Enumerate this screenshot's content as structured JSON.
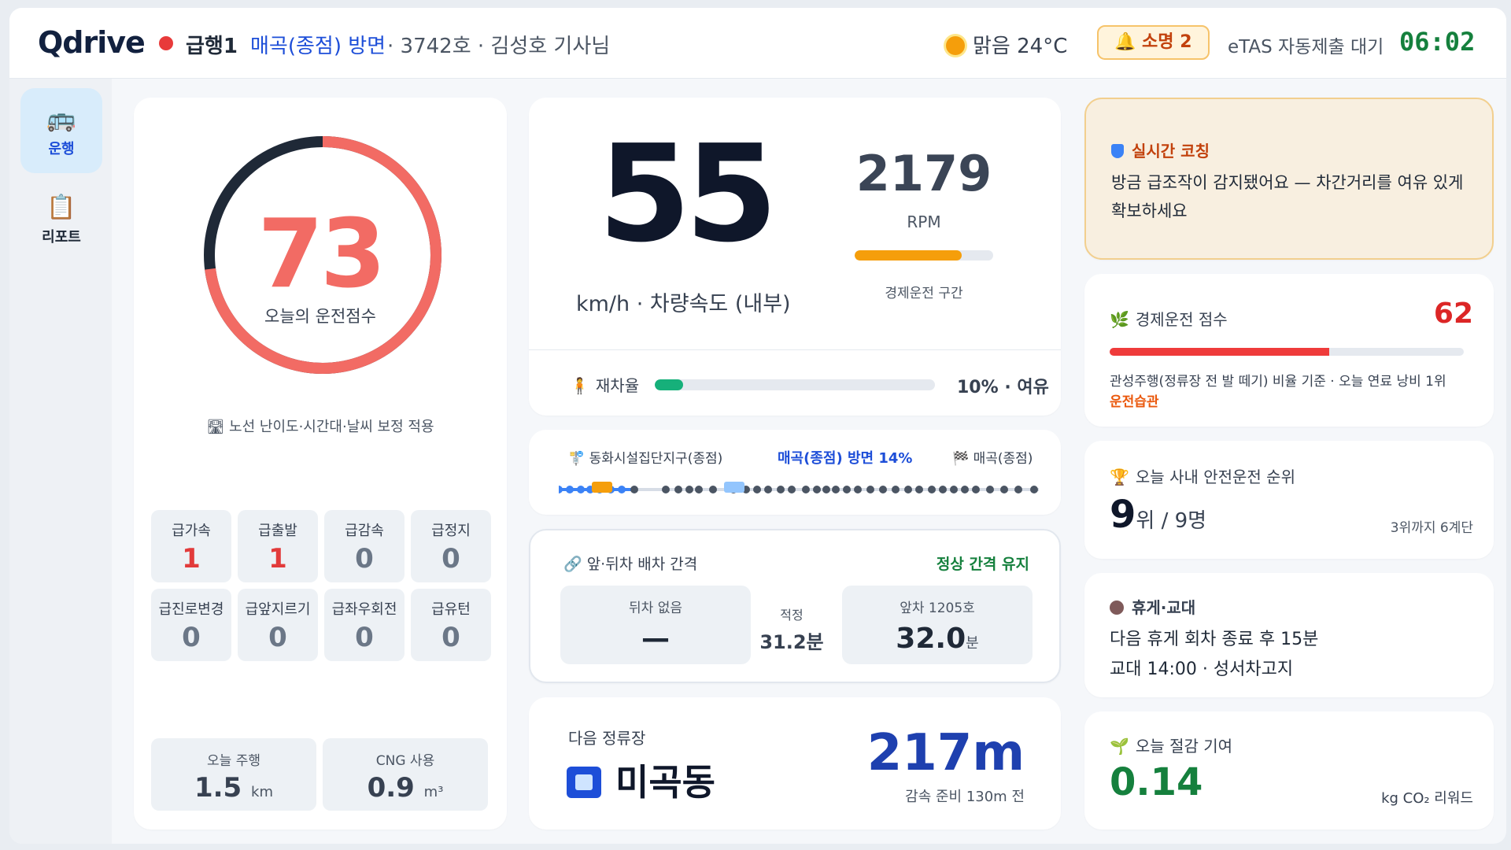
{
  "header": {
    "logo": "Qdrive",
    "route_no": "급행1",
    "route_dest": "매곡(종점) 방면",
    "route_info": "· 3742호 · 김성호 기사님",
    "weather": "맑음 24°C",
    "alert": "🔔 소명 2",
    "etas": "eTAS 자동제출 대기",
    "clock": "06:02",
    "weather_icon": "sun-icon",
    "accent_color": "#15803d"
  },
  "sidebar": {
    "items": [
      {
        "label": "운행",
        "icon": "bus-icon",
        "active": true
      },
      {
        "label": "리포트",
        "icon": "clipboard-icon",
        "active": false
      }
    ]
  },
  "score": {
    "value": "73",
    "label": "오늘의 운전점수",
    "note": "🛣 노선 난이도·시간대·날씨 보정 적용",
    "fraction": 0.73,
    "color": "#f26b64"
  },
  "events": [
    {
      "name": "급가속",
      "value": "1",
      "alert": true
    },
    {
      "name": "급출발",
      "value": "1",
      "alert": true
    },
    {
      "name": "급감속",
      "value": "0",
      "alert": false
    },
    {
      "name": "급정지",
      "value": "0",
      "alert": false
    },
    {
      "name": "급진로변경",
      "value": "0",
      "alert": false
    },
    {
      "name": "급앞지르기",
      "value": "0",
      "alert": false
    },
    {
      "name": "급좌우회전",
      "value": "0",
      "alert": false
    },
    {
      "name": "급유턴",
      "value": "0",
      "alert": false
    }
  ],
  "stats": {
    "distance_label": "오늘 주행",
    "distance_value": "1.5",
    "distance_unit": "km",
    "cng_label": "CNG 사용",
    "cng_value": "0.9",
    "cng_unit": "m³"
  },
  "speed": {
    "value": "55",
    "unit": "km/h · 차량속도 (내부)",
    "rpm_value": "2179",
    "rpm_label": "RPM",
    "rpm_fraction": 0.77,
    "rpm_zone": "경제운전 구간",
    "load_label": "재차율",
    "load_value": "10% · 여유",
    "load_fraction": 0.1
  },
  "route": {
    "start": "🚏 동화시설집단지구(종점)",
    "current": "매곡(종점) 방면 14%",
    "end": "🏁 매곡(종점)",
    "progress": 0.14
  },
  "headway": {
    "title": "🔗 앞·뒤차 배차 간격",
    "status": "정상 간격 유지",
    "behind_label": "뒤차 없음",
    "behind_value": "—",
    "mid_label": "적정",
    "mid_value": "31.2분",
    "ahead_label": "앞차 1205호",
    "ahead_value": "32.0",
    "ahead_unit": "분"
  },
  "next_stop": {
    "label": "다음 정류장",
    "name": "미곡동",
    "distance": "217m",
    "decel": "감속 준비 130m 전"
  },
  "coach": {
    "title": "실시간 코칭",
    "text": "방금 급조작이 감지됐어요 — 차간거리를 여유 있게 확보하세요"
  },
  "eco": {
    "title": "경제운전 점수",
    "score": "62",
    "fraction": 0.62,
    "desc": "관성주행(정류장 전 발 떼기) 비율 기준 · 오늘 연료 낭비 1위",
    "habit": "운전습관"
  },
  "rank": {
    "title": "오늘 사내 안전운전 순위",
    "rank": "9",
    "rank_suffix": "위 / 9명",
    "sub": "3위까지 6계단"
  },
  "break": {
    "title": "휴게·교대",
    "line1": "다음 휴게 회차 종료 후 15분",
    "line2": "교대 14:00 · 성서차고지"
  },
  "saving": {
    "title": "오늘 절감 기여",
    "value": "0.14",
    "unit": "kg CO₂ 리워드"
  }
}
